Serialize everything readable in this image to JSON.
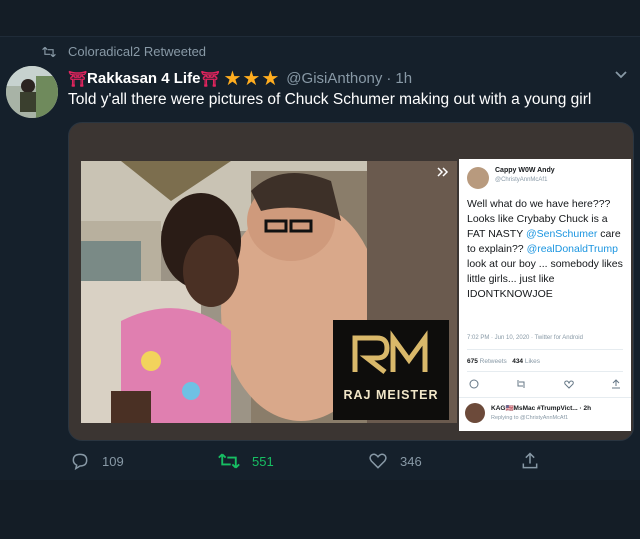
{
  "retweet": {
    "text": "Coloradical2 Retweeted"
  },
  "author": {
    "prefix_emoji": "⛩",
    "name": "Rakkasan 4 Life",
    "suffix_emoji": "⛩",
    "stars": "★★★",
    "handle": "@GisiAnthony",
    "separator": "·",
    "time": "1h"
  },
  "tweet_text": "Told y'all there were pictures of Chuck Schumer making out with a young girl",
  "watermark": {
    "brand": "RAJ MEISTER"
  },
  "embedded_tweet": {
    "name": "Cappy W0W Andy",
    "handle": "@ChristyAnnMcAf1",
    "line1": "Well what do we have here??? Looks like Crybaby Chuck is a FAT NASTY",
    "mention1": "@SenSchumer",
    "line2": "care to explain??",
    "mention2": "@realDonaldTrump",
    "line3": "look at our boy ... somebody likes little girls... just like IDONTKNOWJOE",
    "timestamp": "7:02 PM · Jun 10, 2020 · Twitter for Android",
    "retweets_count": "675",
    "retweets_label": "Retweets",
    "likes_count": "434",
    "likes_label": "Likes",
    "reply_name": "KAG🇺🇸MsMac #TrumpVict...",
    "reply_time": "2h",
    "reply_meta": "Replying to @ChristyAnnMcAf1"
  },
  "actions": {
    "replies": "109",
    "retweets": "551",
    "likes": "346"
  },
  "colors": {
    "background": "#15202b",
    "secondary_text": "#8899a6",
    "retweet_green": "#17bf63",
    "star_gold": "#ffad1f",
    "torii_red": "#e0245e"
  }
}
